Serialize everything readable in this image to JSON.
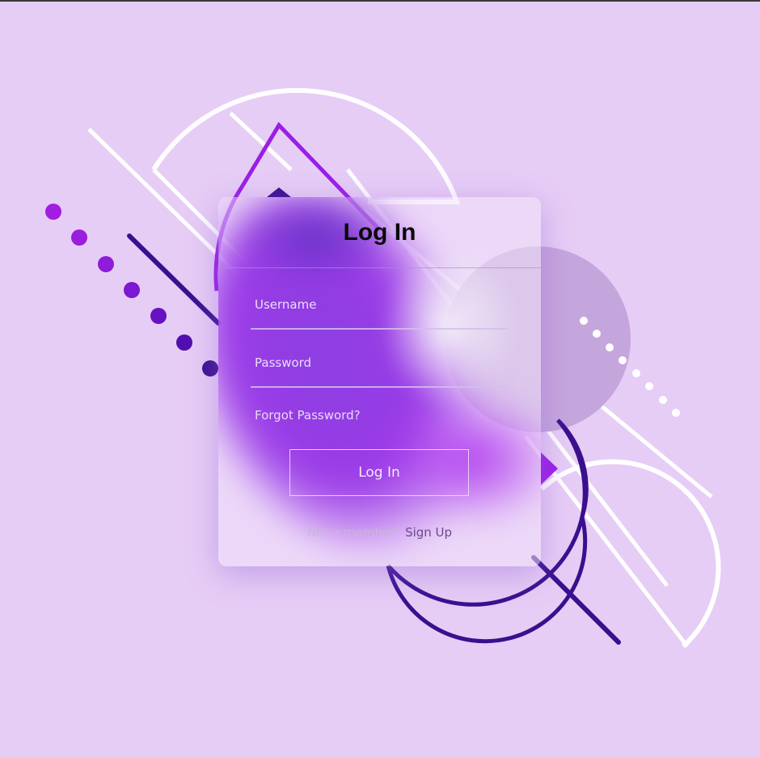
{
  "colors": {
    "background": "#e6cdf5",
    "accent": "#9c3be8",
    "deep_purple": "#3a0f8f",
    "line_white": "#ffffff"
  },
  "login": {
    "title": "Log In",
    "username_placeholder": "Username",
    "password_placeholder": "Password",
    "forgot_password": "Forgot Password?",
    "submit_label": "Log In",
    "footer_prompt": "Not a member?",
    "signup_link": "Sign Up"
  }
}
